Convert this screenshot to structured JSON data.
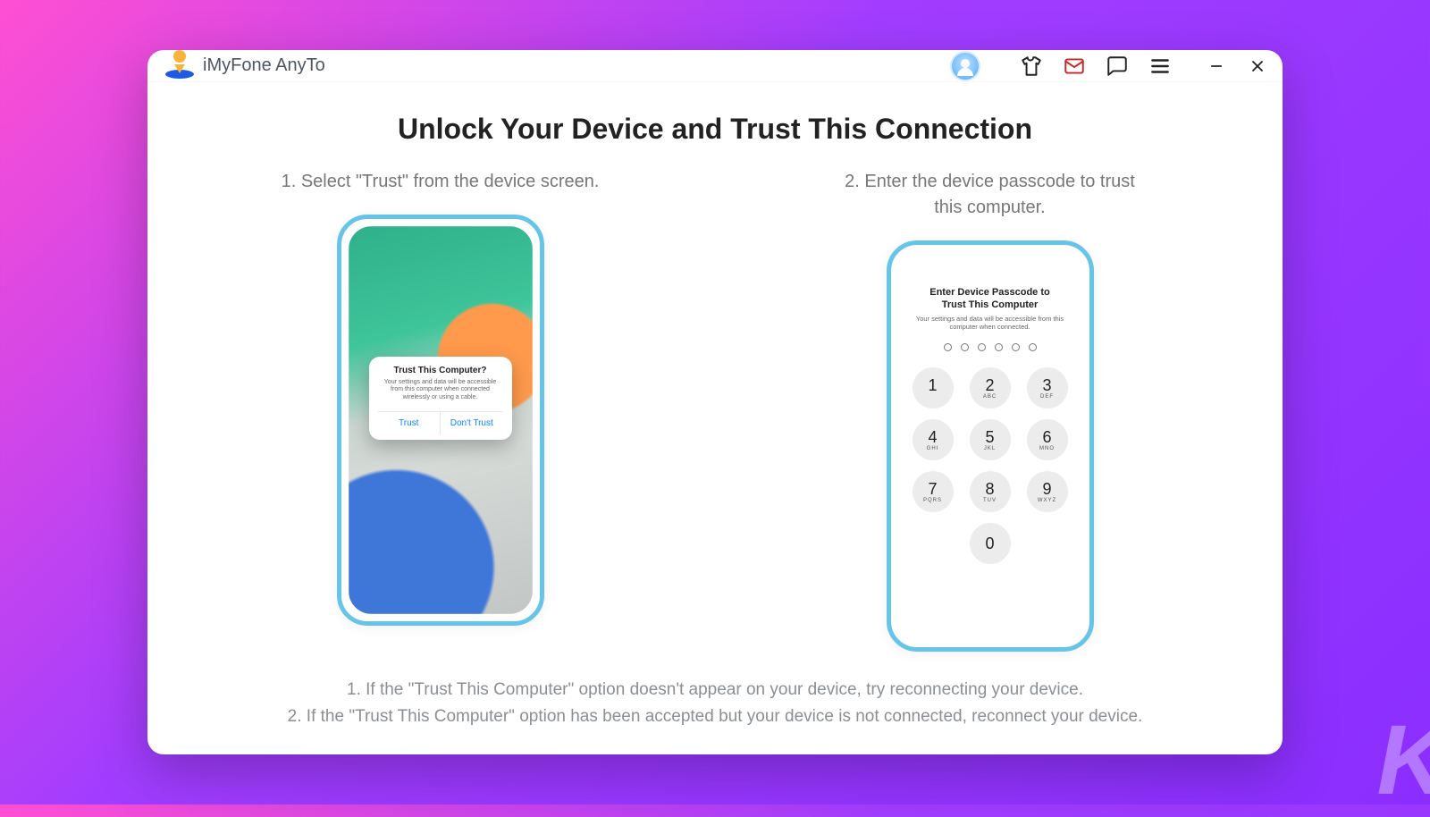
{
  "app": {
    "title": "iMyFone AnyTo"
  },
  "page": {
    "heading": "Unlock Your Device and Trust This Connection"
  },
  "steps": {
    "one": {
      "caption": "1. Select \"Trust\" from the device screen.",
      "alert": {
        "title": "Trust This Computer?",
        "body": "Your settings and data will be accessible from this computer when connected wirelessly or using a cable.",
        "trust": "Trust",
        "dont_trust": "Don't Trust"
      }
    },
    "two": {
      "caption": "2. Enter the device passcode to trust this computer.",
      "pc_title": "Enter Device Passcode to Trust This Computer",
      "pc_sub": "Your settings and data will be accessible from this computer when connected.",
      "keys": {
        "k1": "1",
        "k2": "2",
        "k3": "3",
        "k4": "4",
        "k5": "5",
        "k6": "6",
        "k7": "7",
        "k8": "8",
        "k9": "9",
        "k0": "0",
        "l2": "ABC",
        "l3": "DEF",
        "l4": "GHI",
        "l5": "JKL",
        "l6": "MNO",
        "l7": "PQRS",
        "l8": "TUV",
        "l9": "WXYZ"
      }
    }
  },
  "footnotes": {
    "n1": "1. If the \"Trust This Computer\" option doesn't appear on your device, try reconnecting your device.",
    "n2": "2. If the \"Trust This Computer\" option has been accepted but your device is not connected, reconnect your device."
  },
  "watermark": "K"
}
